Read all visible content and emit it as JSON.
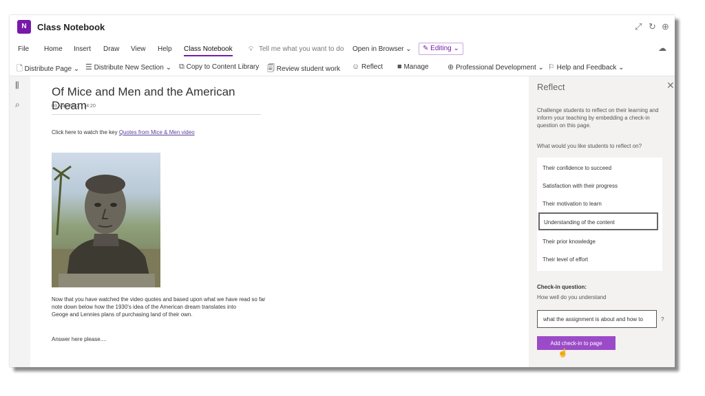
{
  "app": {
    "icon_label": "N",
    "title": "Class Notebook"
  },
  "menu": {
    "items": [
      "File",
      "Home",
      "Insert",
      "Draw",
      "View",
      "Help",
      "Class Notebook"
    ],
    "tell_me": "Tell me what you want to do",
    "open_in_browser": "Open in Browser",
    "editing": "Editing"
  },
  "toolbar": {
    "distribute_page": "Distribute Page",
    "distribute_new_section": "Distribute New Section",
    "copy_to_content_library": "Copy to Content Library",
    "review_student_work": "Review student work",
    "reflect": "Reflect",
    "manage": "Manage",
    "professional_development": "Professional Development",
    "help_and_feedback": "Help and Feedback"
  },
  "page": {
    "title": "Of Mice and Men and the American Dream",
    "date": "03 May 2022",
    "time": "14:20",
    "intro_prefix": "Click here to watch the key ",
    "intro_link": "Quotes from Mice & Men video",
    "paragraph_lines": [
      "Now that you have watched the video quotes and based upon what we have read so far",
      "note down below how the 1930's idea of the American dream translates into",
      "Geoge and Lennies plans of purchasing land of their own."
    ],
    "answer": "Answer here please...."
  },
  "reflect_pane": {
    "title": "Reflect",
    "description": "Challenge students to reflect on their learning and inform your teaching by embedding a check-in question on this page.",
    "question": "What would you like students to reflect on?",
    "options": [
      "Their confidence to succeed",
      "Satisfaction with their progress",
      "Their motivation to learn",
      "Understanding of the content",
      "Their prior knowledge",
      "Their level of effort"
    ],
    "selected_option": "Understanding of the content",
    "checkin_label": "Check-in question:",
    "checkin_text": "How well do you understand",
    "checkin_value": "what the assignment is about and how to",
    "checkin_suffix": "?",
    "add_button": "Add check-in to page"
  },
  "colors": {
    "accent": "#7719aa",
    "button": "#9b4bc7",
    "pane_bg": "#f3f2f1"
  }
}
